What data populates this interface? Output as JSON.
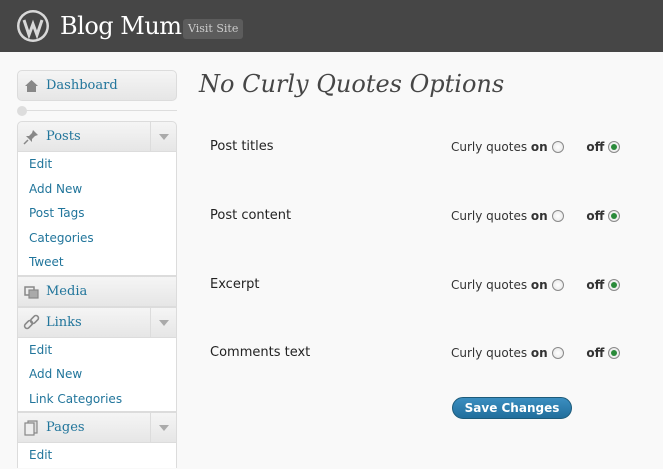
{
  "header": {
    "site_title": "Blog Mum",
    "visit_site_label": "Visit Site"
  },
  "sidebar": {
    "dashboard": "Dashboard",
    "posts": {
      "label": "Posts",
      "items": [
        "Edit",
        "Add New",
        "Post Tags",
        "Categories",
        "Tweet"
      ]
    },
    "media": "Media",
    "links": {
      "label": "Links",
      "items": [
        "Edit",
        "Add New",
        "Link Categories"
      ]
    },
    "pages": {
      "label": "Pages",
      "items": [
        "Edit"
      ]
    }
  },
  "main": {
    "title": "No Curly Quotes Options",
    "options": [
      {
        "label": "Post titles",
        "selected": "off"
      },
      {
        "label": "Post content",
        "selected": "off"
      },
      {
        "label": "Excerpt",
        "selected": "off"
      },
      {
        "label": "Comments text",
        "selected": "off"
      }
    ],
    "curly_text": "Curly quotes",
    "on_label": "on",
    "off_label": "off",
    "save_label": "Save Changes"
  }
}
